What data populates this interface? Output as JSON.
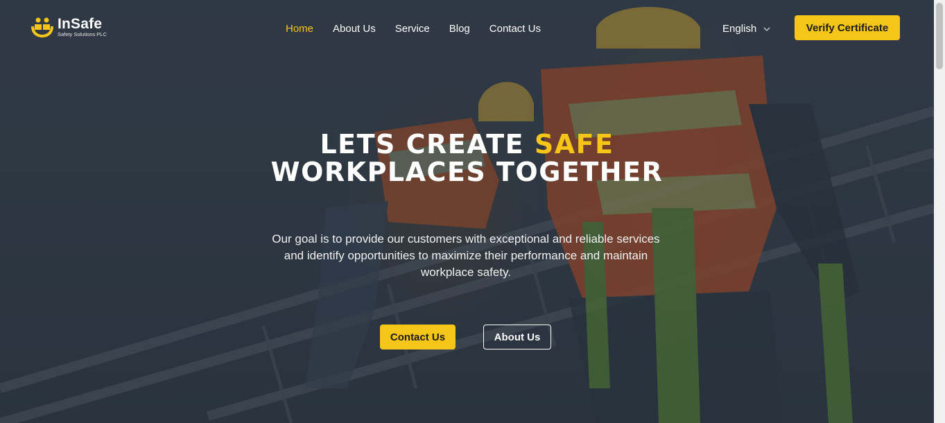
{
  "brand": {
    "name": "InSafe",
    "tagline": "Safety Solutions PLC",
    "accent_color": "#f5c518",
    "logo_icon": "people-hands-icon"
  },
  "nav": {
    "items": [
      {
        "label": "Home",
        "active": true
      },
      {
        "label": "About Us",
        "active": false
      },
      {
        "label": "Service",
        "active": false
      },
      {
        "label": "Blog",
        "active": false
      },
      {
        "label": "Contact Us",
        "active": false
      }
    ]
  },
  "language": {
    "selected": "English",
    "icon": "chevron-down-icon"
  },
  "header_cta": {
    "label": "Verify Certificate"
  },
  "hero": {
    "headline_part1": "LETS CREATE ",
    "headline_highlight": "SAFE",
    "headline_line2": "WORKPLACES TOGETHER",
    "subtitle": "Our goal is to provide our customers with exceptional and reliable services and identify opportunities to maximize their performance and maintain workplace safety.",
    "primary_button": "Contact Us",
    "secondary_button": "About Us",
    "background_image": "workers-climbing-ladder-photo"
  }
}
